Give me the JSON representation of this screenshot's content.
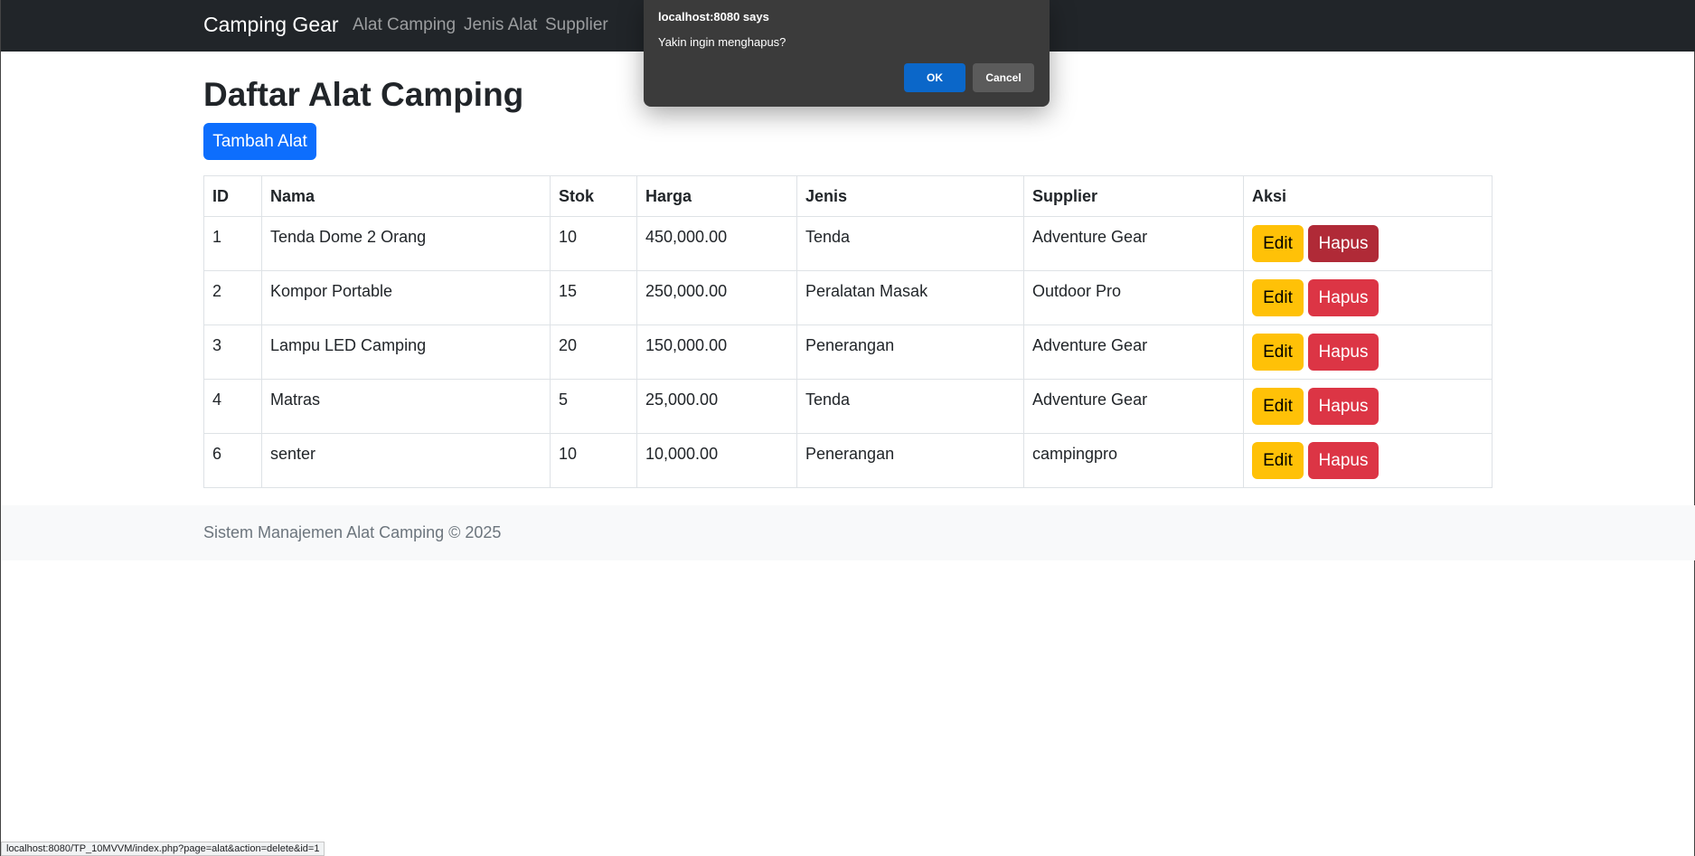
{
  "navbar": {
    "brand": "Camping Gear",
    "links": [
      "Alat Camping",
      "Jenis Alat",
      "Supplier"
    ]
  },
  "page_title": "Daftar Alat Camping",
  "add_button": "Tambah Alat",
  "table": {
    "headers": [
      "ID",
      "Nama",
      "Stok",
      "Harga",
      "Jenis",
      "Supplier",
      "Aksi"
    ],
    "rows": [
      {
        "id": "1",
        "nama": "Tenda Dome 2 Orang",
        "stok": "10",
        "harga": "450,000.00",
        "jenis": "Tenda",
        "supplier": "Adventure Gear"
      },
      {
        "id": "2",
        "nama": "Kompor Portable",
        "stok": "15",
        "harga": "250,000.00",
        "jenis": "Peralatan Masak",
        "supplier": "Outdoor Pro"
      },
      {
        "id": "3",
        "nama": "Lampu LED Camping",
        "stok": "20",
        "harga": "150,000.00",
        "jenis": "Penerangan",
        "supplier": "Adventure Gear"
      },
      {
        "id": "4",
        "nama": "Matras",
        "stok": "5",
        "harga": "25,000.00",
        "jenis": "Tenda",
        "supplier": "Adventure Gear"
      },
      {
        "id": "6",
        "nama": "senter",
        "stok": "10",
        "harga": "10,000.00",
        "jenis": "Penerangan",
        "supplier": "campingpro"
      }
    ],
    "edit_label": "Edit",
    "delete_label": "Hapus"
  },
  "footer": "Sistem Manajemen Alat Camping © 2025",
  "dialog": {
    "title": "localhost:8080 says",
    "message": "Yakin ingin menghapus?",
    "ok": "OK",
    "cancel": "Cancel"
  },
  "status_url": "localhost:8080/TP_10MVVM/index.php?page=alat&action=delete&id=1",
  "colors": {
    "navbar": "#212529",
    "primary": "#0d6efd",
    "warning": "#ffc107",
    "danger": "#dc3545",
    "dialog_bg": "#3b3b3b",
    "dialog_ok": "#0b67c9"
  }
}
